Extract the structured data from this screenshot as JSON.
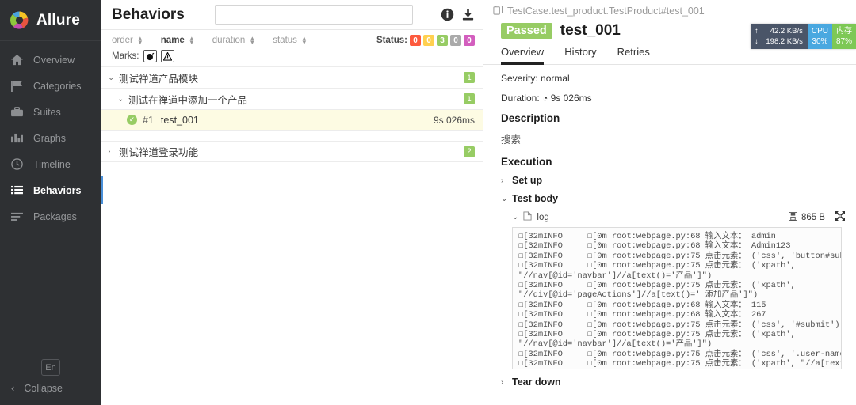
{
  "sidebar": {
    "brand": "Allure",
    "items": [
      {
        "label": "Overview",
        "icon": "home-icon"
      },
      {
        "label": "Categories",
        "icon": "flag-icon"
      },
      {
        "label": "Suites",
        "icon": "briefcase-icon"
      },
      {
        "label": "Graphs",
        "icon": "bar-chart-icon"
      },
      {
        "label": "Timeline",
        "icon": "clock-icon"
      },
      {
        "label": "Behaviors",
        "icon": "list-icon"
      },
      {
        "label": "Packages",
        "icon": "align-left-icon"
      }
    ],
    "active_index": 5,
    "language": "En",
    "collapse": "Collapse"
  },
  "middle": {
    "title": "Behaviors",
    "search_value": "",
    "search_placeholder": "",
    "sorts": [
      {
        "label": "order",
        "bold": false
      },
      {
        "label": "name",
        "bold": true
      },
      {
        "label": "duration",
        "bold": false
      },
      {
        "label": "status",
        "bold": false
      }
    ],
    "status_label": "Status:",
    "status_chips": [
      {
        "value": "0",
        "color": "#fd5a3e"
      },
      {
        "value": "0",
        "color": "#ffd050"
      },
      {
        "value": "3",
        "color": "#97cc64"
      },
      {
        "value": "0",
        "color": "#aaaaaa"
      },
      {
        "value": "0",
        "color": "#d35ebe"
      }
    ],
    "marks_label": "Marks:",
    "marks": [
      {
        "name": "flaky-mark",
        "glyph": "◕"
      },
      {
        "name": "warning-mark",
        "glyph": "⚠"
      }
    ],
    "tree": [
      {
        "level": 1,
        "caret": "⌄",
        "label": "测试禅道产品模块",
        "badge": "1"
      },
      {
        "level": 2,
        "caret": "⌄",
        "label": "测试在禅道中添加一个产品",
        "badge": "1"
      },
      {
        "level": 3,
        "num": "#1",
        "label": "test_001",
        "duration": "9s 026ms",
        "status": "passed"
      },
      {
        "level": 1,
        "caret": "›",
        "label": "测试禅道登录功能",
        "badge": "2"
      }
    ]
  },
  "right": {
    "breadcrumb": "TestCase.test_product.TestProduct#test_001",
    "status_badge": "Passed",
    "case_title": "test_001",
    "tabs": [
      {
        "label": "Overview",
        "active": true
      },
      {
        "label": "History",
        "active": false
      },
      {
        "label": "Retries",
        "active": false
      }
    ],
    "severity": "Severity: normal",
    "duration": "Duration: ◔ 9s 026ms",
    "description_heading": "Description",
    "description_text": "搜索",
    "execution_heading": "Execution",
    "steps": [
      {
        "label": "Set up",
        "caret": "›",
        "expanded": false
      },
      {
        "label": "Test body",
        "caret": "⌄",
        "expanded": true
      },
      {
        "label": "Tear down",
        "caret": "›",
        "expanded": false
      }
    ],
    "log": {
      "name": "log",
      "caret": "⌄",
      "size": "865 B",
      "lines": [
        "☐[32mINFO     ☐[0m root:webpage.py:68 输入文本： admin",
        "☐[32mINFO     ☐[0m root:webpage.py:68 输入文本： Admin123",
        "☐[32mINFO     ☐[0m root:webpage.py:75 点击元素： ('css', 'button#submit')",
        "☐[32mINFO     ☐[0m root:webpage.py:75 点击元素： ('xpath',",
        "\"//nav[@id='navbar']//a[text()='产品']\")",
        "☐[32mINFO     ☐[0m root:webpage.py:75 点击元素： ('xpath',",
        "\"//div[@id='pageActions']//a[text()=' 添加产品']\")",
        "☐[32mINFO     ☐[0m root:webpage.py:68 输入文本： 115",
        "☐[32mINFO     ☐[0m root:webpage.py:68 输入文本： 267",
        "☐[32mINFO     ☐[0m root:webpage.py:75 点击元素： ('css', '#submit')",
        "☐[32mINFO     ☐[0m root:webpage.py:75 点击元素： ('xpath',",
        "\"//nav[@id='navbar']//a[text()='产品']\")",
        "☐[32mINFO     ☐[0m root:webpage.py:75 点击元素： ('css', '.user-name')",
        "☐[32mINFO     ☐[0m root:webpage.py:75 点击元素： ('xpath', \"//a[text()='退出']\")"
      ]
    }
  },
  "sysmon": {
    "upload": "42.2 KB/s",
    "download": "198.2 KB/s",
    "cpu_label": "CPU",
    "cpu_value": "30%",
    "mem_label": "内存",
    "mem_value": "87%"
  }
}
